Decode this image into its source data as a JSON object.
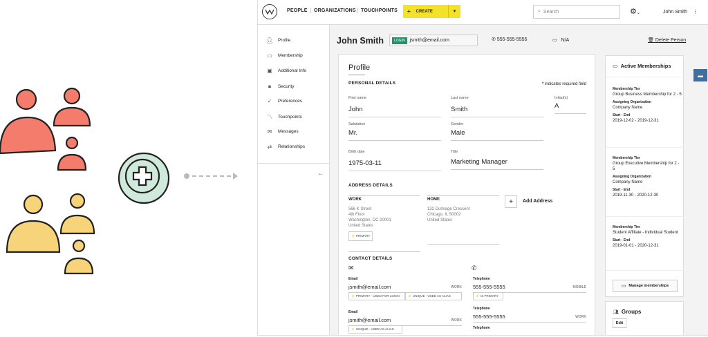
{
  "nav": {
    "people": "PEOPLE",
    "organizations": "ORGANIZATIONS",
    "touchpoints": "TOUCHPOINTS",
    "create_plus": "+",
    "create": "CREATE",
    "search_placeholder": "Search",
    "user": "John Smith"
  },
  "sidebar": {
    "items": [
      {
        "label": "Profile",
        "icon": "person-icon"
      },
      {
        "label": "Membership",
        "icon": "monitor-icon"
      },
      {
        "label": "Additional Info",
        "icon": "id-card-icon"
      },
      {
        "label": "Security",
        "icon": "lock-icon"
      },
      {
        "label": "Preferences",
        "icon": "check-icon"
      },
      {
        "label": "Touchpoints",
        "icon": "trend-icon"
      },
      {
        "label": "Messages",
        "icon": "mail-icon"
      },
      {
        "label": "Relationships",
        "icon": "relationship-icon"
      }
    ]
  },
  "header": {
    "name": "John Smith",
    "login_badge": "LOGIN",
    "login_email": "jsmith@email.com",
    "phone": "555-555-5555",
    "na": "N/A",
    "delete": "Delete Person"
  },
  "profile": {
    "title": "Profile",
    "personal_details": "PERSONAL DETAILS",
    "required_note": "indicates required field",
    "first_name_label": "First name",
    "first_name": "John",
    "last_name_label": "Last name",
    "last_name": "Smith",
    "initials_label": "Initial(s)",
    "initials": "A",
    "salutation_label": "Salutation",
    "salutation": "Mr.",
    "gender_label": "Gender",
    "gender": "Male",
    "birth_label": "Birth date",
    "birth": "1975-03-11",
    "title_label": "Title",
    "job_title": "Marketing Manager",
    "address_details": "ADDRESS DETAILS",
    "work_label": "WORK",
    "work_lines": [
      "566 K Street",
      "4th Floor",
      "Washington, DC 20001",
      "United States"
    ],
    "primary_tag": "PRIMARY",
    "home_label": "HOME",
    "home_lines": [
      "132 Dulmage Crescent",
      "Chicago, IL 50002",
      "United States"
    ],
    "add_address": "Add Address",
    "contact_details": "CONTACT DETAILS",
    "email_label": "Email",
    "email1": "jsmith@email.com",
    "email1_type": "WORK",
    "email1_tag1": "PRIMARY - USED FOR LOGIN",
    "email1_tag2": "UNIQUE - USED AS ALIAS",
    "email2": "jsmith@email.com",
    "email2_type": "WORK",
    "email2_tag": "UNIQUE - USED AS ALIAS",
    "tel_label": "Telephone",
    "tel1": "555-555-5555",
    "tel1_type": "MOBILE",
    "tel1_tag": "IS PRIMARY",
    "tel2": "555-555-5555",
    "tel2_type": "WORK"
  },
  "memberships": {
    "title": "Active Memberships",
    "tier_label": "Membership Tier",
    "org_label": "Assigning Organization",
    "dates_label": "Start - End",
    "items": [
      {
        "tier": "Group Business Membership for 2 - 5",
        "org": "Company Name",
        "dates": "2019-12-02 - 2019-12-31"
      },
      {
        "tier": "Group Executive Membership for 2 - 5",
        "org": "Company Name",
        "dates": "2019-11-30 - 2020-12-30"
      },
      {
        "tier": "Student Affiliate - Individual Student",
        "dates": "2019-01-01 - 2020-12-31"
      }
    ],
    "manage": "Manage memberships"
  },
  "groups": {
    "title": "Groups",
    "edit": "Edit"
  },
  "colors": {
    "accent": "#f4e12a",
    "badge": "#2a8f6c",
    "coral": "#f47c6c",
    "yellow": "#f7d47a",
    "mint": "#cfe9dc",
    "chat": "#3d6fa1"
  }
}
